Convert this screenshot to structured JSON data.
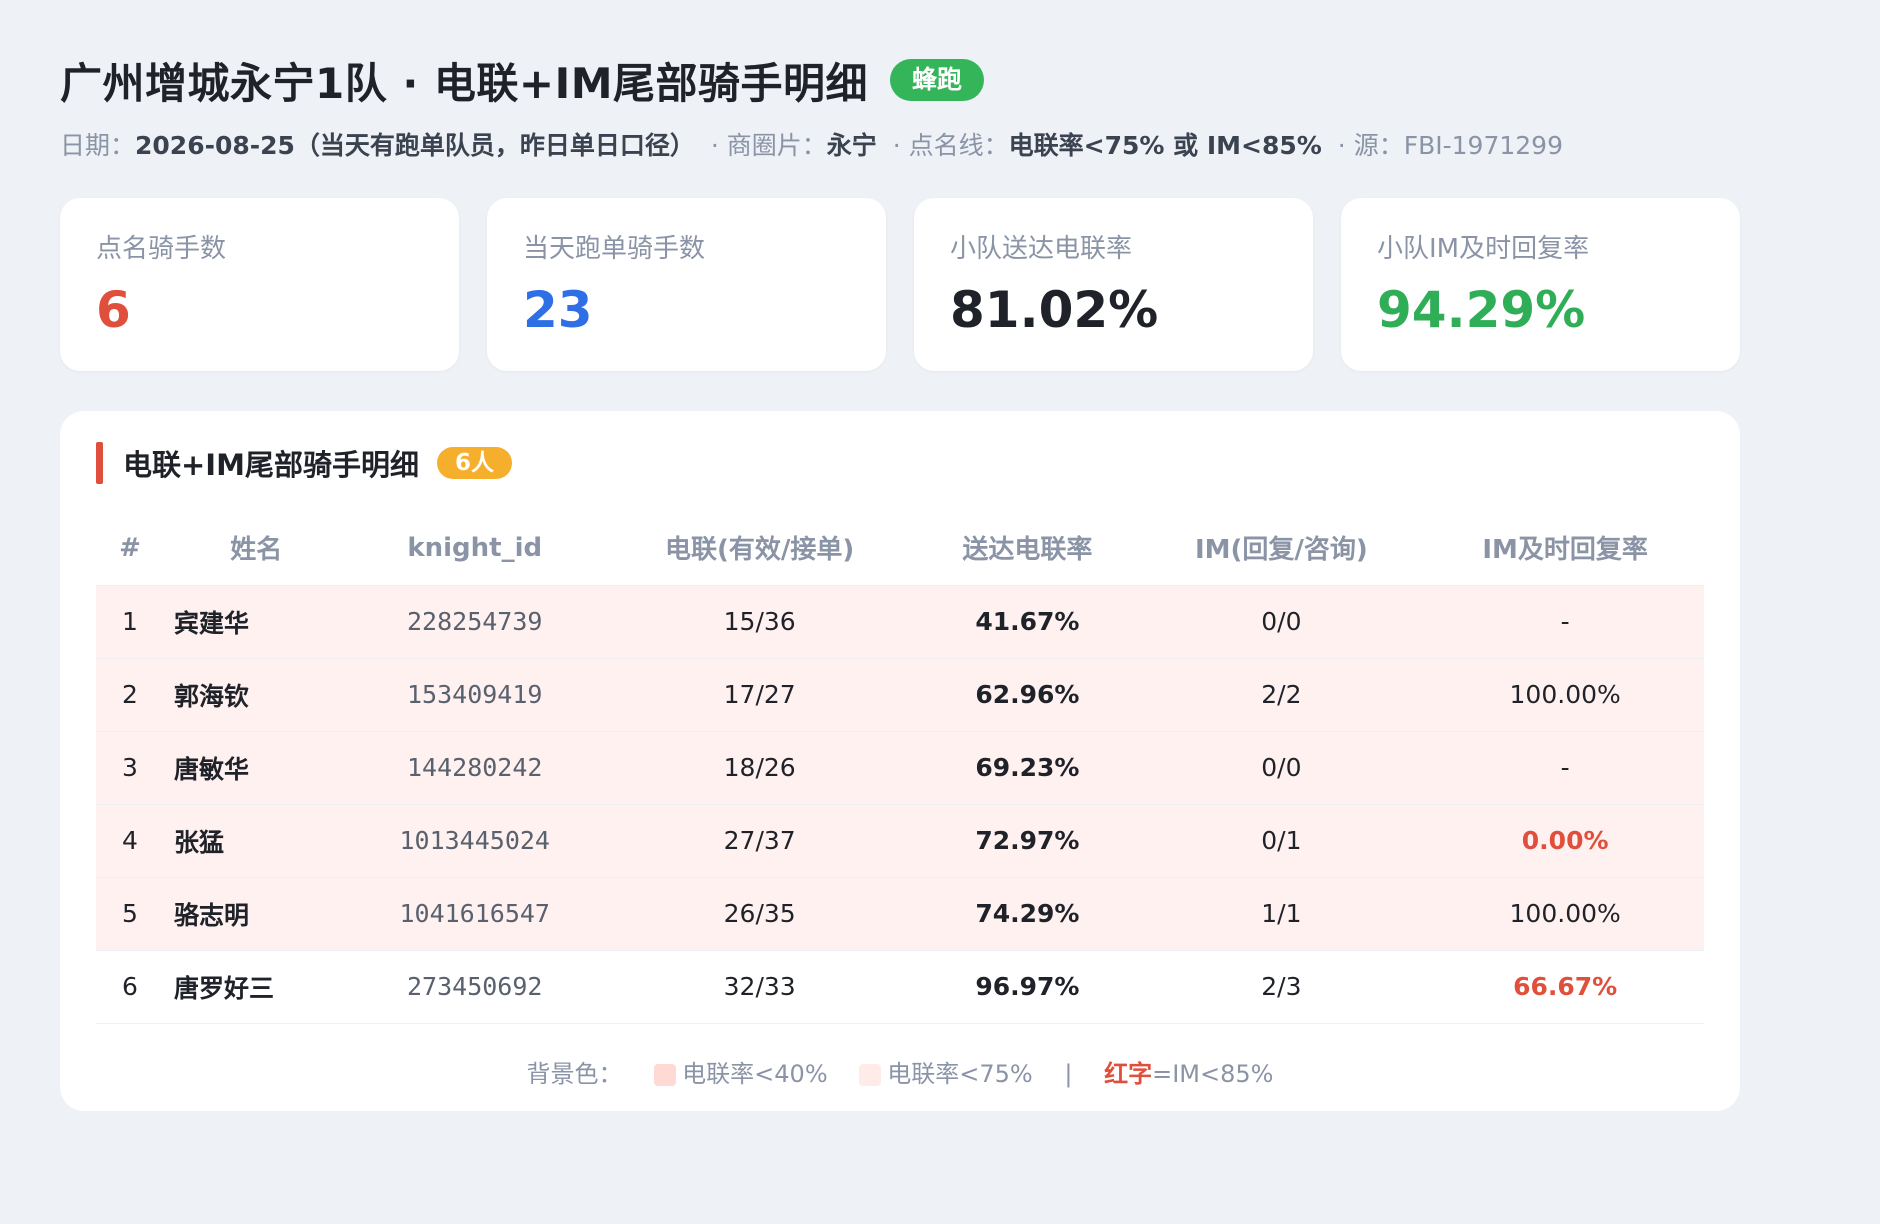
{
  "header": {
    "title": "广州增城永宁1队 · 电联+IM尾部骑手明细",
    "tag": "蜂跑",
    "date_label": "日期：",
    "date_value": "2026-08-25（当天有跑单队员，昨日单日口径）",
    "area_label": "· 商圈片：",
    "area_value": "永宁",
    "threshold_label": "· 点名线：",
    "threshold_value": "电联率<75% 或 IM<85%",
    "source_label": "· 源：",
    "source_value": "FBI-1971299"
  },
  "colors": {
    "red": "#e04f3c",
    "blue": "#2f6fe6",
    "dark": "#1f2329",
    "green": "#2fae57",
    "row_warn_bg": "#fff1f0",
    "legend_strong": "#ffd9d3",
    "legend_light": "#ffece9"
  },
  "cards": [
    {
      "label": "点名骑手数",
      "value": "6",
      "color": "#e04f3c"
    },
    {
      "label": "当天跑单骑手数",
      "value": "23",
      "color": "#2f6fe6"
    },
    {
      "label": "小队送达电联率",
      "value": "81.02%",
      "color": "#1f2329"
    },
    {
      "label": "小队IM及时回复率",
      "value": "94.29%",
      "color": "#2fae57"
    }
  ],
  "panel": {
    "title": "电联+IM尾部骑手明细",
    "count_badge": "6人"
  },
  "table": {
    "columns": [
      "#",
      "姓名",
      "knight_id",
      "电联(有效/接单)",
      "送达电联率",
      "IM(回复/咨询)",
      "IM及时回复率"
    ],
    "rows": [
      {
        "idx": "1",
        "name": "宾建华",
        "knight_id": "228254739",
        "call": "15/36",
        "call_rate": "41.67%",
        "im": "0/0",
        "im_rate": "-",
        "warn": true,
        "im_red": false
      },
      {
        "idx": "2",
        "name": "郭海钦",
        "knight_id": "153409419",
        "call": "17/27",
        "call_rate": "62.96%",
        "im": "2/2",
        "im_rate": "100.00%",
        "warn": true,
        "im_red": false
      },
      {
        "idx": "3",
        "name": "唐敏华",
        "knight_id": "144280242",
        "call": "18/26",
        "call_rate": "69.23%",
        "im": "0/0",
        "im_rate": "-",
        "warn": true,
        "im_red": false
      },
      {
        "idx": "4",
        "name": "张猛",
        "knight_id": "1013445024",
        "call": "27/37",
        "call_rate": "72.97%",
        "im": "0/1",
        "im_rate": "0.00%",
        "warn": true,
        "im_red": true
      },
      {
        "idx": "5",
        "name": "骆志明",
        "knight_id": "1041616547",
        "call": "26/35",
        "call_rate": "74.29%",
        "im": "1/1",
        "im_rate": "100.00%",
        "warn": true,
        "im_red": false
      },
      {
        "idx": "6",
        "name": "唐罗好三",
        "knight_id": "273450692",
        "call": "32/33",
        "call_rate": "96.97%",
        "im": "2/3",
        "im_rate": "66.67%",
        "warn": false,
        "im_red": true
      }
    ]
  },
  "legend": {
    "prefix": "背景色：",
    "item1": "电联率<40%",
    "item2": "电联率<75%",
    "pipe": "|",
    "red_word": "红字",
    "red_rule": "=IM<85%"
  }
}
